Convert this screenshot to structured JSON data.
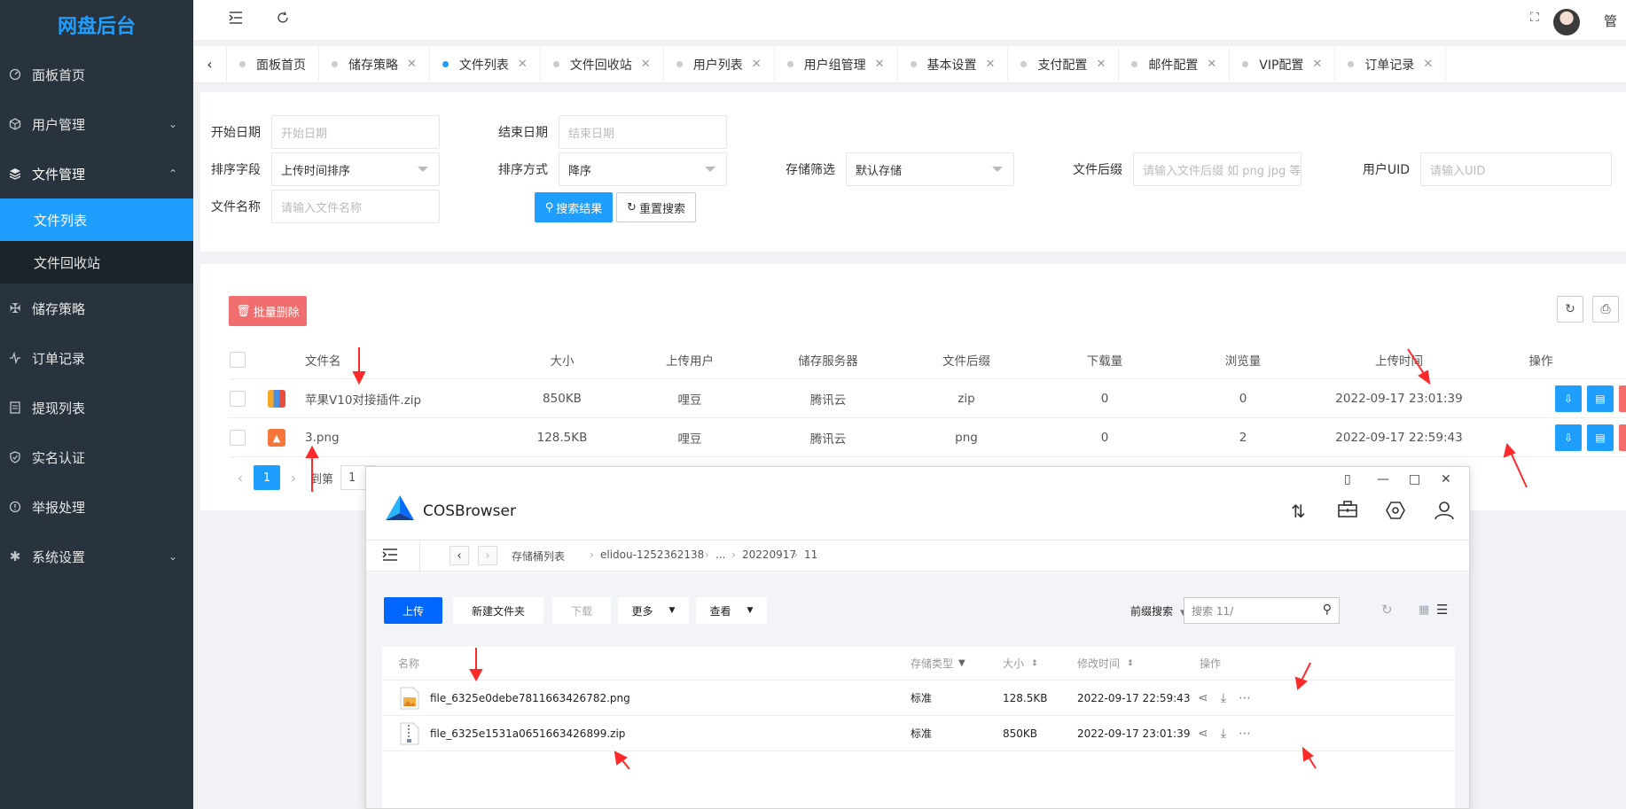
{
  "app": {
    "logo": "网盘后台",
    "admin": "管"
  },
  "sidebar": {
    "items": [
      {
        "label": "面板首页",
        "icon": "dashboard-icon"
      },
      {
        "label": "用户管理",
        "icon": "user-icon"
      },
      {
        "label": "文件管理",
        "icon": "file-stack-icon"
      },
      {
        "label": "储存策略",
        "icon": "strategy-icon"
      },
      {
        "label": "订单记录",
        "icon": "pulse-icon"
      },
      {
        "label": "提现列表",
        "icon": "list-icon"
      },
      {
        "label": "实名认证",
        "icon": "shield-check-icon"
      },
      {
        "label": "举报处理",
        "icon": "report-icon"
      },
      {
        "label": "系统设置",
        "icon": "gear-icon"
      }
    ],
    "sub": [
      {
        "label": "文件列表"
      },
      {
        "label": "文件回收站"
      }
    ]
  },
  "tabs": [
    {
      "label": "面板首页"
    },
    {
      "label": "储存策略"
    },
    {
      "label": "文件列表"
    },
    {
      "label": "文件回收站"
    },
    {
      "label": "用户列表"
    },
    {
      "label": "用户组管理"
    },
    {
      "label": "基本设置"
    },
    {
      "label": "支付配置"
    },
    {
      "label": "邮件配置"
    },
    {
      "label": "VIP配置"
    },
    {
      "label": "订单记录"
    }
  ],
  "filters": {
    "start_label": "开始日期",
    "start_placeholder": "开始日期",
    "end_label": "结束日期",
    "end_placeholder": "结束日期",
    "sort_field_label": "排序字段",
    "sort_field_value": "上传时间排序",
    "sort_order_label": "排序方式",
    "sort_order_value": "降序",
    "storage_label": "存储筛选",
    "storage_value": "默认存储",
    "suffix_label": "文件后缀",
    "suffix_placeholder": "请输入文件后缀 如 png jpg 等",
    "uid_label": "用户UID",
    "uid_placeholder": "请输入UID",
    "name_label": "文件名称",
    "name_placeholder": "请输入文件名称",
    "search_btn": "搜索结果",
    "reset_btn": "重置搜索"
  },
  "table": {
    "batch_delete": "批量删除",
    "headers": [
      "文件名",
      "大小",
      "上传用户",
      "储存服务器",
      "文件后缀",
      "下载量",
      "浏览量",
      "上传时间",
      "操作"
    ],
    "rows": [
      {
        "name": "苹果V10对接插件.zip",
        "size": "850KB",
        "user": "哩豆",
        "server": "腾讯云",
        "suffix": "zip",
        "downloads": "0",
        "views": "0",
        "time": "2022-09-17 23:01:39",
        "type": "zip"
      },
      {
        "name": "3.png",
        "size": "128.5KB",
        "user": "哩豆",
        "server": "腾讯云",
        "suffix": "png",
        "downloads": "0",
        "views": "2",
        "time": "2022-09-17 22:59:43",
        "type": "image"
      }
    ],
    "pager": {
      "current": "1",
      "goto_label": "到第",
      "goto_value": "1"
    }
  },
  "cos": {
    "title": "COSBrowser",
    "crumbs": [
      "存储桶列表",
      "elidou-1252362138",
      "...",
      "20220917",
      "11"
    ],
    "buttons": {
      "upload": "上传",
      "new_folder": "新建文件夹",
      "download": "下载",
      "more": "更多",
      "view": "查看"
    },
    "prefix_search": "前缀搜索",
    "search_placeholder": "搜索 11/",
    "headers": {
      "name": "名称",
      "storage": "存储类型",
      "size": "大小",
      "modified": "修改时间",
      "ops": "操作"
    },
    "rows": [
      {
        "name": "file_6325e0debe7811663426782.png",
        "storage": "标准",
        "size": "128.5KB",
        "modified": "2022-09-17 22:59:43",
        "type": "image"
      },
      {
        "name": "file_6325e1531a0651663426899.zip",
        "storage": "标准",
        "size": "850KB",
        "modified": "2022-09-17 23:01:39",
        "type": "zip"
      }
    ]
  },
  "colors": {
    "sidebar": "#28333e",
    "accent": "#1e9fff",
    "danger": "#f06e6e",
    "annotation": "#ff2a2a"
  }
}
